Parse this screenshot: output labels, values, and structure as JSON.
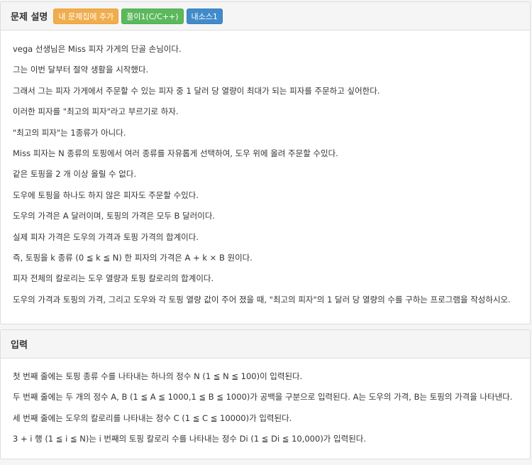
{
  "description_panel": {
    "title": "문제 설명",
    "buttons": {
      "add_to_collection": "내 문제집에 추가",
      "solution": "풀이1(C/C++)",
      "my_source": "내소스1"
    },
    "paragraphs": [
      "vega 선생님은 Miss 피자 가게의 단골 손님이다.",
      "그는 이번 달부터 절약 생활을 시작했다.",
      "그래서 그는 피자 가게에서 주문할 수 있는 피자 중 1 달러 당 열량이 최대가 되는 피자를 주문하고 싶어한다.",
      "이러한 피자를 \"최고의 피자\"라고 부르기로 하자.",
      "\"최고의 피자\"는 1종류가 아니다.",
      "Miss 피자는 N 종류의 토핑에서 여러 종류를 자유롭게 선택하여, 도우 위에 올려 주문할 수있다.",
      "같은 토핑을 2 개 이상 올릴 수 없다.",
      "도우에 토핑을 하나도 하지 않은  피자도 주문할 수있다.",
      "도우의 가격은 A 달러이며, 토핑의 가격은 모두 B 달러이다.",
      "실제 피자 가격은 도우의 가격과 토핑 가격의 합계이다.",
      "즉, 토핑을 k 종류 (0 ≦ k ≦ N) 한 피자의 가격은 A + k × B 원이다.",
      "피자 전체의 칼로리는 도우 열량과 토핑 칼로리의 합계이다.",
      "도우의 가격과 토핑의 가격, 그리고 도우와 각 토핑 열량 값이 주어 졌을 때, \"최고의 피자\"의 1 달러 당 열량의 수를 구하는 프로그램을 작성하시오."
    ]
  },
  "input_panel": {
    "title": "입력",
    "paragraphs": [
      "첫 번째 줄에는 토핑 종류 수를 나타내는 하나의 정수 N (1 ≦ N ≦ 100)이 입력된다.",
      "두 번째 줄에는 두 개의 정수 A, B (1 ≦ A ≦ 1000,1 ≦ B ≦ 1000)가 공백을 구분으로 입력된다. A는 도우의 가격, B는 토핑의 가격을 나타낸다.",
      "세 번째 줄에는 도우의 칼로리를 나타내는 정수 C (1 ≦ C ≦ 10000)가 입력된다.",
      "3 + i 행 (1 ≦ i ≦ N)는 i 번째의 토핑 칼로리 수를 나타내는 정수 Di (1 ≦ Di ≦ 10,000)가 입력된다."
    ]
  },
  "colors": {
    "add_button": "#f0ad4e",
    "solution_button": "#5cb85c",
    "source_button": "#428bca",
    "heading_bg": "#f5f5f5",
    "text": "#333333"
  }
}
